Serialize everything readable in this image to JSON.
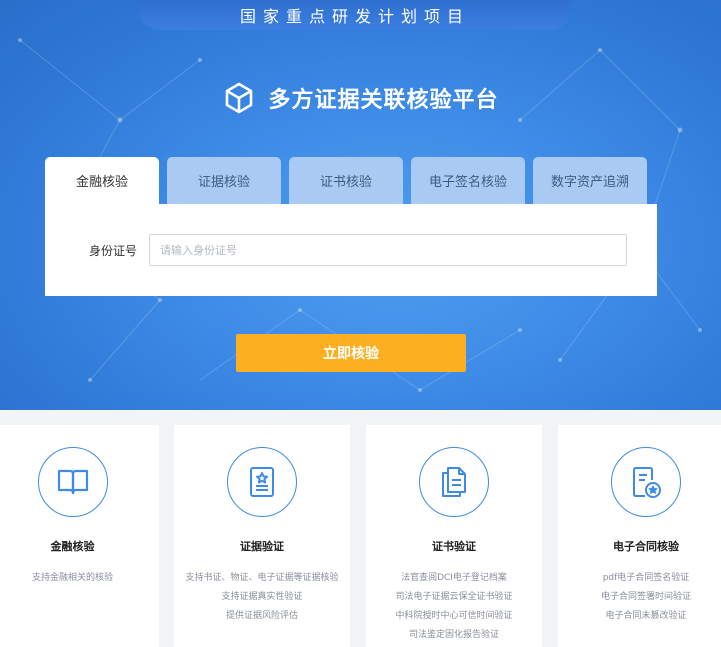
{
  "header": {
    "banner": "国家重点研发计划项目",
    "title": "多方证据关联核验平台"
  },
  "tabs": [
    {
      "label": "金融核验",
      "active": true
    },
    {
      "label": "证据核验",
      "active": false
    },
    {
      "label": "证书核验",
      "active": false
    },
    {
      "label": "电子签名核验",
      "active": false
    },
    {
      "label": "数字资产追溯",
      "active": false
    }
  ],
  "form": {
    "id_label": "身份证号",
    "id_placeholder": "请输入身份证号",
    "id_value": "",
    "submit_label": "立即核验"
  },
  "features": [
    {
      "title": "金融核验",
      "icon": "book-icon",
      "lines": [
        "支持金融相关的核验"
      ]
    },
    {
      "title": "证据验证",
      "icon": "certificate-icon",
      "lines": [
        "支持书证、物证、电子证据等证据核验",
        "支持证据真实性验证",
        "提供证据风险评估"
      ]
    },
    {
      "title": "证书验证",
      "icon": "documents-icon",
      "lines": [
        "法官查阅DCI电子登记档案",
        "司法电子证据云保全证书验证",
        "中科院授时中心可信时间验证",
        "司法鉴定固化报告验证"
      ]
    },
    {
      "title": "电子合同核验",
      "icon": "contract-seal-icon",
      "lines": [
        "pdf电子合同签名验证",
        "电子合同签署时间验证",
        "电子合同未篡改验证"
      ]
    }
  ],
  "colors": {
    "primary": "#3d8be6",
    "tab_inactive": "#a9cbf3",
    "button": "#fbaf21",
    "page_bg": "#f2f4f8"
  }
}
